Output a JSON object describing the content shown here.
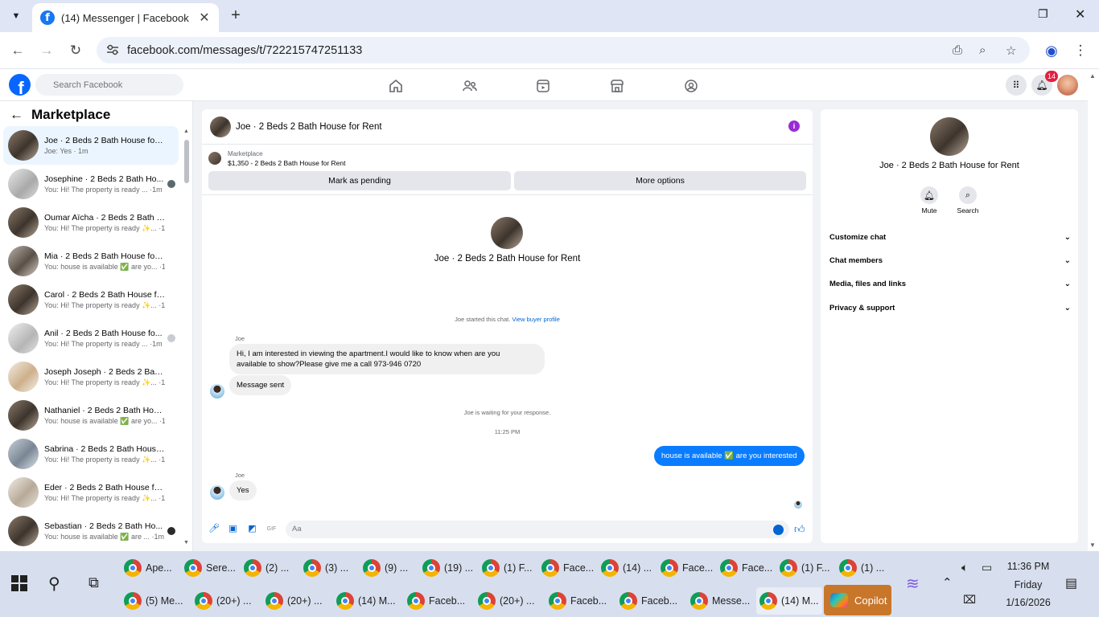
{
  "browser": {
    "tab_title": "(14) Messenger | Facebook",
    "tab_favicon": "f",
    "url": "facebook.com/messages/t/722215747251133"
  },
  "fb": {
    "search_placeholder": "Search Facebook",
    "notification_count": "14",
    "brand_color": "#0866ff"
  },
  "sidebar": {
    "title": "Marketplace",
    "chats": [
      {
        "name": "Joe · 2 Beds 2 Bath House for R...",
        "preview": "Joe: Yes · 1m"
      },
      {
        "name": "Josephine · 2 Beds 2 Bath Ho...",
        "preview": "You: Hi! The property is ready ... ·1m"
      },
      {
        "name": "Oumar Aïcha · 2 Beds 2 Bath H...",
        "preview": "You: Hi! The property is ready ✨... ·1m"
      },
      {
        "name": "Mia · 2 Beds 2 Bath House for ...",
        "preview": "You: house is available ✅ are yo... ·1m"
      },
      {
        "name": "Carol · 2 Beds 2 Bath House for...",
        "preview": "You: Hi! The property is ready ✨... ·1m"
      },
      {
        "name": "Anil · 2 Beds 2 Bath House fo...",
        "preview": "You: Hi! The property is ready ... ·1m"
      },
      {
        "name": "Joseph Joseph · 2 Beds 2 Bath ...",
        "preview": "You: Hi! The property is ready ✨... ·1m"
      },
      {
        "name": "Nathaniel · 2 Beds 2 Bath Hous...",
        "preview": "You: house is available ✅ are yo... ·1m"
      },
      {
        "name": "Sabrina · 2 Beds 2 Bath House f...",
        "preview": "You: Hi! The property is ready ✨... ·1m"
      },
      {
        "name": "Eder · 2 Beds 2 Bath House for ...",
        "preview": "You: Hi! The property is ready ✨... ·1m"
      },
      {
        "name": "Sebastian · 2 Beds 2 Bath Ho...",
        "preview": "You: house is available ✅ are ... ·1m"
      }
    ]
  },
  "conversation": {
    "title": "Joe · 2 Beds 2 Bath House for Rent",
    "marketplace_label": "Marketplace",
    "listing": "$1,350 - 2 Beds 2 Bath House for Rent",
    "mark_pending": "Mark as pending",
    "more_options": "More options",
    "center_title": "Joe · 2 Beds 2 Bath House for Rent",
    "started_text": "Joe started this chat.",
    "view_profile": "View buyer profile",
    "sender_1": "Joe",
    "msg_1_line1": "Hi, I am interested in viewing the apartment.I would like to know when are you",
    "msg_1_line2": "available to show?Please give me a call 973-946 0720",
    "msg_2": "Message sent",
    "waiting": "Joe is waiting for your response.",
    "time": "11:25 PM",
    "outgoing": "house is available ✅ are you interested",
    "sender_2": "Joe",
    "msg_3": "Yes",
    "composer_placeholder": "Aa"
  },
  "right_panel": {
    "name": "Joe · 2 Beds 2 Bath House for Rent",
    "mute": "Mute",
    "search": "Search",
    "sections": [
      "Customize chat",
      "Chat members",
      "Media, files and links",
      "Privacy & support"
    ]
  },
  "taskbar": {
    "row1": [
      "Ape...",
      "Sere...",
      "(2) ...",
      "(3) ...",
      "(9) ...",
      "(19) ...",
      "(1) F...",
      "Face...",
      "(14) ...",
      "Face...",
      "Face...",
      "(1) F...",
      "(1) ..."
    ],
    "row2": [
      "(5) Me...",
      "(20+) ...",
      "(20+) ...",
      "(14) M...",
      "Faceb...",
      "(20+) ...",
      "Faceb...",
      "Faceb...",
      "Messe...",
      "(14) M..."
    ],
    "copilot": "Copilot",
    "time": "11:36 PM",
    "day": "Friday",
    "date": "1/16/2026"
  }
}
